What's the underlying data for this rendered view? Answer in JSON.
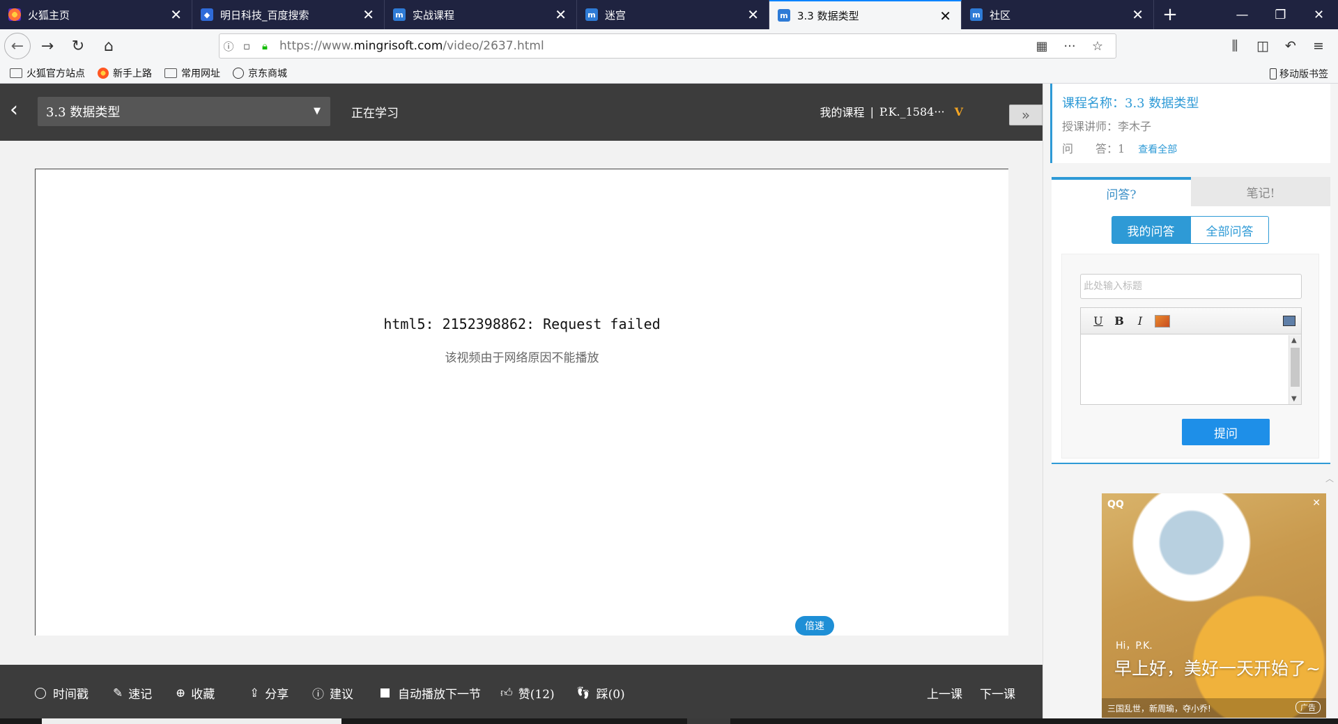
{
  "browser": {
    "tabs": [
      {
        "title": "火狐主页",
        "icon": "firefox-icon"
      },
      {
        "title": "明日科技_百度搜索",
        "icon": "baidu-icon"
      },
      {
        "title": "实战课程",
        "icon": "mingrisoft-icon"
      },
      {
        "title": "迷宫",
        "icon": "mingrisoft-icon"
      },
      {
        "title": "3.3 数据类型",
        "icon": "mingrisoft-icon",
        "active": true
      },
      {
        "title": "社区",
        "icon": "mingrisoft-icon"
      }
    ],
    "url_prefix": "https://www.",
    "url_domain": "mingrisoft.com",
    "url_path": "/video/2637.html",
    "bookmarks": [
      "火狐官方站点",
      "新手上路",
      "常用网址",
      "京东商城"
    ],
    "mobile_bookmarks": "移动版书签"
  },
  "page": {
    "lesson_select": "3.3 数据类型",
    "studying": "正在学习",
    "my_course": "我的课程",
    "user": "P.K._1584···",
    "error_title": "html5: 2152398862: Request failed",
    "error_sub": "该视频由于网络原因不能播放",
    "speed": "倍速",
    "bottom": {
      "timestamp": "时间戳",
      "notes": "速记",
      "favorite": "收藏",
      "share": "分享",
      "suggest": "建议",
      "autoplay": "自动播放下一节",
      "like": "赞(12)",
      "dislike": "踩(0)",
      "prev": "上一课",
      "next": "下一课"
    }
  },
  "panel": {
    "course_name": "课程名称：3.3 数据类型",
    "teacher": "授课讲师：李木子",
    "qa_label": "问　　答：1",
    "view_all": "查看全部",
    "tab_qa": "问答?",
    "tab_notes": "笔记!",
    "seg_mine": "我的问答",
    "seg_all": "全部问答",
    "title_placeholder": "此处输入标题",
    "ask": "提问",
    "ad": {
      "brand": "QQ",
      "hi": "Hi，P.K.",
      "headline": "早上好，美好一天开始了~",
      "footer": "三国乱世，新周瑜，夺小乔!",
      "tag": "广告"
    }
  },
  "colors": {
    "accent": "#2e9ad6",
    "topbar": "#3c3c3c",
    "tabstrip": "#1f2340"
  }
}
